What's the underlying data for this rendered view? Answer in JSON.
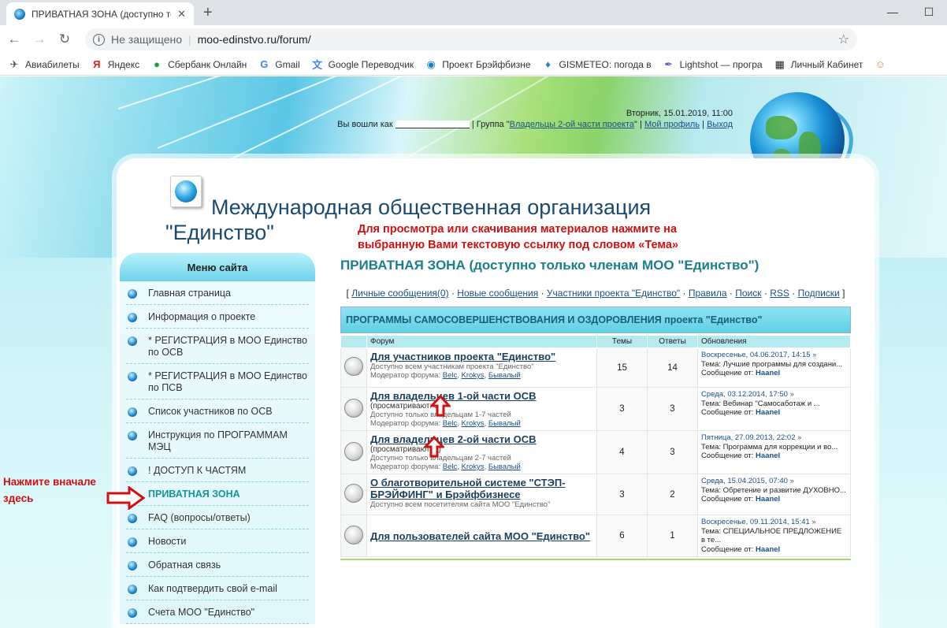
{
  "browser": {
    "tab_title": "ПРИВАТНАЯ ЗОНА (доступно то",
    "security_label": "Не защищено",
    "url": "moo-edinstvo.ru/forum/",
    "bookmarks": [
      {
        "label": "Авиабилеты",
        "icon": "plane-icon"
      },
      {
        "label": "Яндекс",
        "icon": "yandex-icon"
      },
      {
        "label": "Сбербанк Онлайн",
        "icon": "sberbank-icon"
      },
      {
        "label": "Gmail",
        "icon": "google-icon"
      },
      {
        "label": "Google Переводчик",
        "icon": "translate-icon"
      },
      {
        "label": "Проект Брэйфбизне",
        "icon": "globe-icon"
      },
      {
        "label": "GISMETEO: погода в",
        "icon": "drop-icon"
      },
      {
        "label": "Lightshot — програ",
        "icon": "feather-icon"
      },
      {
        "label": "Личный Кабинет",
        "icon": "grid-icon"
      }
    ]
  },
  "header": {
    "datetime": "Вторник, 15.01.2019, 11:00",
    "logged_in_prefix": "Вы вошли как",
    "group_prefix": "| Группа \"",
    "group_name": "Владельцы 2-ой части проекта",
    "group_suffix": "\" |",
    "profile_link": "Мой профиль",
    "pipe": "|",
    "logout_link": "Выход"
  },
  "site": {
    "title_line1": "Международная общественная организация",
    "title_line2": "\"Единство\""
  },
  "instruction": {
    "line1": "Для просмотра или скачивания материалов нажмите на",
    "line2": "выбранную Вами текстовую ссылку под словом «Тема»"
  },
  "sidebar": {
    "title": "Меню сайта",
    "items": [
      {
        "label": "Главная страница"
      },
      {
        "label": "Информация о проекте"
      },
      {
        "label": "* РЕГИСТРАЦИЯ в МОО Единство по ОСВ"
      },
      {
        "label": "* РЕГИСТРАЦИЯ в МОО Единство по ПСВ"
      },
      {
        "label": "Список участников по ОСВ"
      },
      {
        "label": "Инструкция по ПРОГРАММАМ МЭЦ"
      },
      {
        "label": "! ДОСТУП К ЧАСТЯМ"
      },
      {
        "label": "ПРИВАТНАЯ ЗОНА"
      },
      {
        "label": "FAQ (вопросы/ответы)"
      },
      {
        "label": "Новости"
      },
      {
        "label": "Обратная связь"
      },
      {
        "label": "Как подтвердить свой e-mail"
      },
      {
        "label": "Счета МОО \"Единство\""
      }
    ]
  },
  "note_left": {
    "line1": "Нажмите вначале",
    "line2": "здесь"
  },
  "forum": {
    "title": "ПРИВАТНАЯ ЗОНА (доступно только членам МОО \"Единство\")",
    "links": [
      "Личные сообщения(0)",
      "Новые сообщения",
      "Участники проекта \"Единство\"",
      "Правила",
      "Поиск",
      "RSS",
      "Подписки"
    ],
    "bracket_open": "[",
    "bracket_close": "]",
    "dot": "·",
    "category": "ПРОГРАММЫ САМОСОВЕРШЕНСТВОВАНИЯ И ОЗДОРОВЛЕНИЯ проекта \"Единство\"",
    "columns": [
      "Форум",
      "Темы",
      "Ответы",
      "Обновления"
    ],
    "mod_prefix": "Модератор форума:",
    "mods": [
      "Belc",
      "Krokys",
      "Бывалый"
    ],
    "rows": [
      {
        "name": "Для участников проекта \"Единство\"",
        "viewers": "",
        "desc": "Доступно всем участникам проекта \"Единство\"",
        "has_mods": true,
        "topics": "15",
        "replies": "14",
        "last_date": "Воскресенье, 04.06.2017, 14:15",
        "last_topic": "Тема: Лучшие программы для создани...",
        "last_author_prefix": "Сообщение от:",
        "last_author": "Haanel"
      },
      {
        "name": "Для владельцев 1-ой части ОСВ",
        "viewers": "(просматривают: 1)",
        "desc": "Доступно только владельцам 1-7 частей",
        "has_mods": true,
        "topics": "3",
        "replies": "3",
        "last_date": "Среда, 03.12.2014, 17:50",
        "last_topic": "Тема: Вебинар \"Самосаботаж и ...",
        "last_author_prefix": "Сообщение от:",
        "last_author": "Haanel"
      },
      {
        "name": "Для владельцев 2-ой части ОСВ",
        "viewers": "(просматривают: 2)",
        "desc": "Доступно только владельцам 2-7 частей",
        "has_mods": true,
        "topics": "4",
        "replies": "3",
        "last_date": "Пятница, 27.09.2013, 22:02",
        "last_topic": "Тема: Программа для коррекции и во...",
        "last_author_prefix": "Сообщение от:",
        "last_author": "Haanel"
      },
      {
        "name": "О благотворительной системе \"СТЭП-БРЭЙФИНГ\" и Брэйфбизнесе",
        "viewers": "",
        "desc": "Доступно всем посетителям сайта МОО \"Единство\"",
        "has_mods": false,
        "topics": "3",
        "replies": "2",
        "last_date": "Среда, 15.04.2015, 07:40",
        "last_topic": "Тема: Обретение и развитие ДУХОВНО...",
        "last_author_prefix": "Сообщение от:",
        "last_author": "Haanel"
      },
      {
        "name": "Для пользователей сайта МОО \"Единство\"",
        "viewers": "",
        "desc": "",
        "has_mods": false,
        "topics": "6",
        "replies": "1",
        "last_date": "Воскресенье, 09.11.2014, 15:41",
        "last_topic": "Тема: СПЕЦИАЛЬНОЕ ПРЕДЛОЖЕНИЕ в те...",
        "last_author_prefix": "Сообщение от:",
        "last_author": "Haanel"
      }
    ]
  },
  "colors": {
    "accent": "#1b7f8a",
    "annotation_red": "#d01111"
  }
}
